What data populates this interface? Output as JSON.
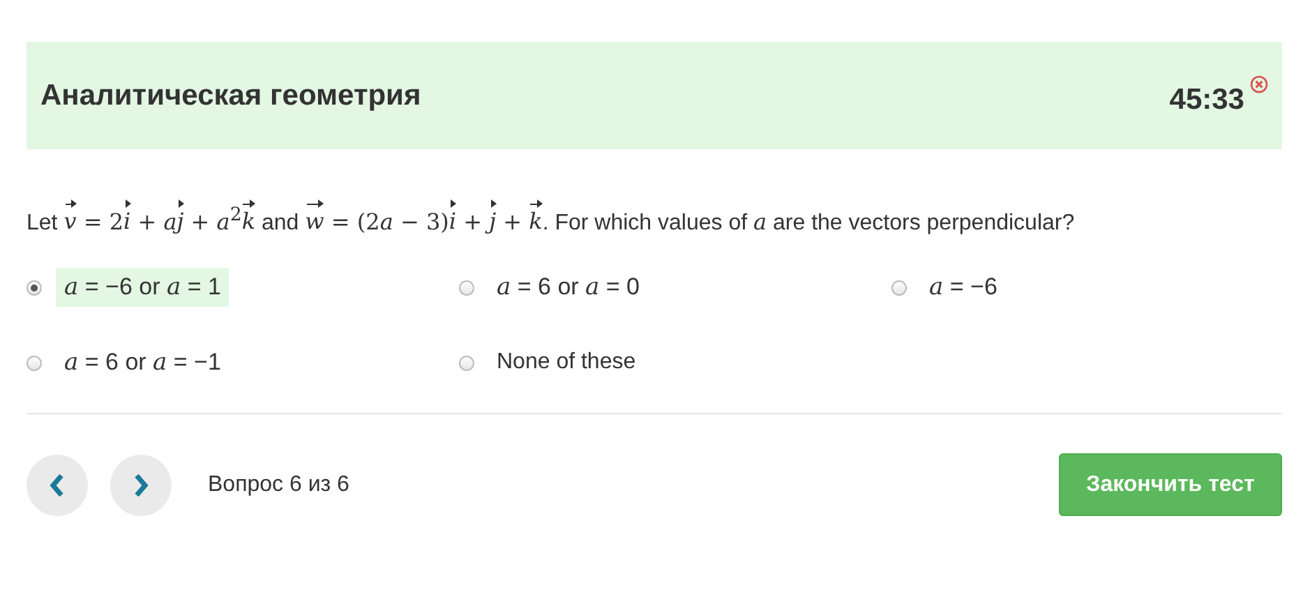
{
  "header": {
    "title": "Аналитическая геометрия",
    "timer": "45:33"
  },
  "question": [
    {
      "kind": "text",
      "text": "Let "
    },
    {
      "kind": "vec",
      "text": "v"
    },
    {
      "kind": "math",
      "text": " = 2"
    },
    {
      "kind": "vec",
      "text": "i"
    },
    {
      "kind": "math",
      "text": " + "
    },
    {
      "kind": "var",
      "text": "a"
    },
    {
      "kind": "vec",
      "text": "j"
    },
    {
      "kind": "math",
      "text": " + "
    },
    {
      "kind": "var",
      "text": "a"
    },
    {
      "kind": "sup",
      "text": "2"
    },
    {
      "kind": "vec",
      "text": "k"
    },
    {
      "kind": "text",
      "text": " and "
    },
    {
      "kind": "vec",
      "text": "w"
    },
    {
      "kind": "math",
      "text": " = (2"
    },
    {
      "kind": "var",
      "text": "a"
    },
    {
      "kind": "math",
      "text": " − 3)"
    },
    {
      "kind": "vec",
      "text": "i"
    },
    {
      "kind": "math",
      "text": " + "
    },
    {
      "kind": "vec",
      "text": "j"
    },
    {
      "kind": "math",
      "text": " + "
    },
    {
      "kind": "vec",
      "text": "k"
    },
    {
      "kind": "text",
      "text": ". For which values of "
    },
    {
      "kind": "var",
      "text": "a"
    },
    {
      "kind": "text",
      "text": " are the vectors perpendicular?"
    }
  ],
  "options": [
    {
      "label": "*a* = −6 or *a* = 1",
      "selected": true
    },
    {
      "label": "*a* = 6 or *a* = 0",
      "selected": false
    },
    {
      "label": "*a* = −6",
      "selected": false
    },
    {
      "label": "*a* = 6 or *a* = −1",
      "selected": false
    },
    {
      "label": "None of these",
      "selected": false
    }
  ],
  "footer": {
    "progress": "Вопрос 6 из 6",
    "finish_button": "Закончить тест"
  }
}
